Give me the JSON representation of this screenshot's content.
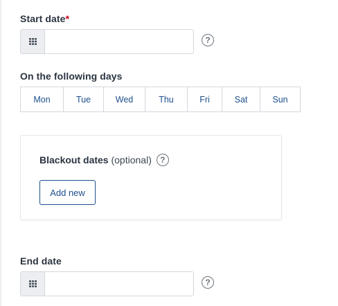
{
  "start_date": {
    "label": "Start date",
    "required_mark": "*",
    "value": "",
    "help_icon": "?"
  },
  "days": {
    "label": "On the following days",
    "items": [
      "Mon",
      "Tue",
      "Wed",
      "Thu",
      "Fri",
      "Sat",
      "Sun"
    ]
  },
  "blackout": {
    "title": "Blackout dates",
    "optional": "(optional)",
    "help_icon": "?",
    "add_new_label": "Add new"
  },
  "end_date": {
    "label": "End date",
    "value": "",
    "help_icon": "?"
  },
  "icons": {
    "calendar": "calendar-grid-icon",
    "help": "question-circle-icon"
  },
  "colors": {
    "accent": "#1d4f8c",
    "required": "#d0021b",
    "text": "#2b3440",
    "border": "#d3d7dd"
  }
}
